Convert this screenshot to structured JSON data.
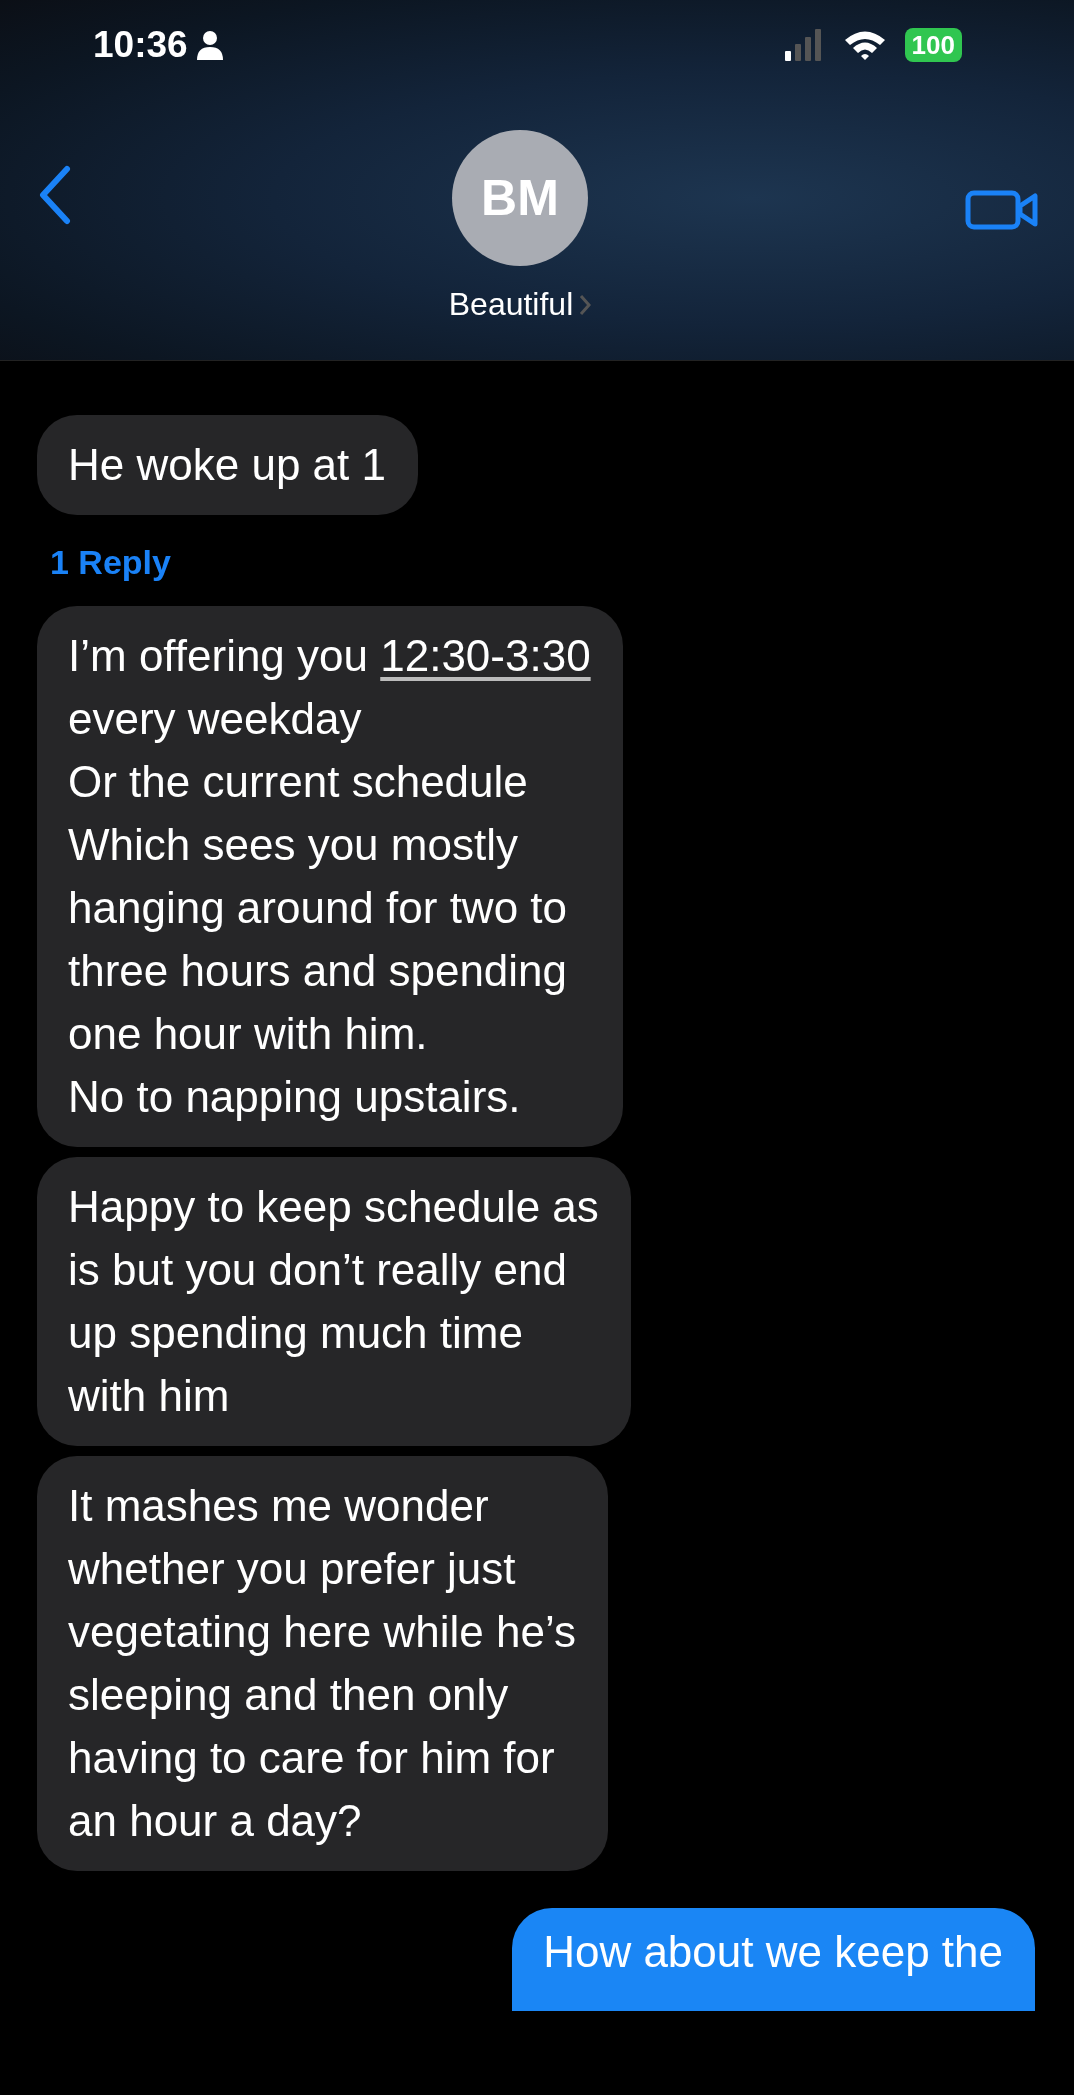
{
  "status_bar": {
    "time": "10:36",
    "battery": "100"
  },
  "header": {
    "avatar_initials": "BM",
    "contact_name": "Beautiful"
  },
  "messages": [
    {
      "kind": "received",
      "parts": [
        {
          "text": "He woke up at 1"
        }
      ]
    },
    {
      "kind": "reply_count",
      "text": "1 Reply"
    },
    {
      "kind": "received",
      "parts": [
        {
          "text": "I’m offering you "
        },
        {
          "text": "12:30-3:30",
          "kind": "link"
        },
        {
          "text": "\nevery weekday\nOr the current schedule\nWhich sees you mostly\nhanging around for two to\nthree hours and spending\none hour with him.\nNo to napping upstairs."
        }
      ]
    },
    {
      "kind": "received",
      "parts": [
        {
          "text": "Happy to keep schedule as\nis but you don’t really end\nup spending much time\nwith him"
        }
      ]
    },
    {
      "kind": "received",
      "parts": [
        {
          "text": "It mashes me wonder\nwhether you prefer just\nvegetating here while he’s\nsleeping and then only\nhaving to care for him for\nan hour a day?"
        }
      ]
    },
    {
      "kind": "sent",
      "parts": [
        {
          "text": "How about we keep the"
        }
      ]
    }
  ]
}
